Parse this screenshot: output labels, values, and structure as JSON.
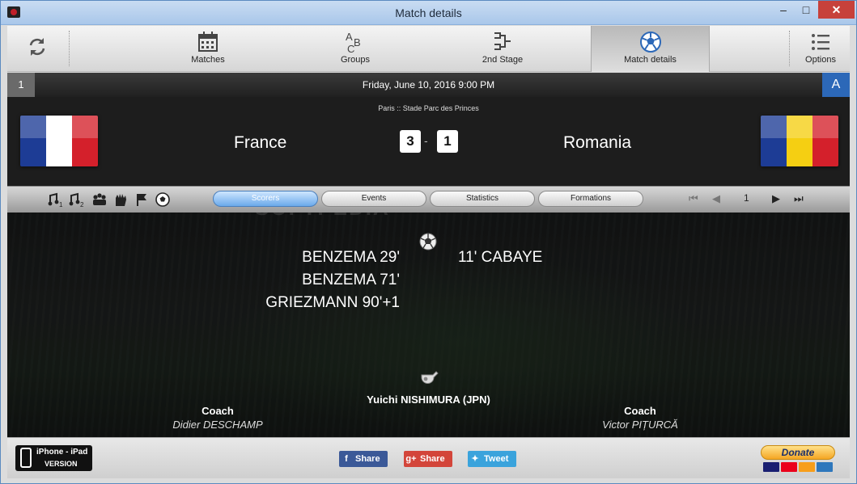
{
  "window": {
    "title": "Match details",
    "controls": {
      "minimize": "–",
      "maximize": "□",
      "close": "✕"
    }
  },
  "toolbar": {
    "refresh_icon": "refresh-icon",
    "items": [
      {
        "label": "Matches",
        "icon": "calendar-icon",
        "active": false
      },
      {
        "label": "Groups",
        "icon": "abc-icon",
        "active": false
      },
      {
        "label": "2nd Stage",
        "icon": "bracket-icon",
        "active": false
      },
      {
        "label": "Match details",
        "icon": "soccer-ball-icon",
        "active": true
      },
      {
        "label": "Options",
        "icon": "list-icon",
        "active": false
      }
    ]
  },
  "match_bar": {
    "match_number": "1",
    "datetime": "Friday, June 10, 2016 9:00 PM",
    "group": "A"
  },
  "match": {
    "venue": "Paris  ::  Stade Parc des Princes",
    "home": {
      "name": "France",
      "score": "3",
      "flag_colors": [
        "#1d3c95",
        "#ffffff",
        "#d4202b"
      ]
    },
    "away": {
      "name": "Romania",
      "score": "1",
      "flag_colors": [
        "#1d3c95",
        "#f5cf12",
        "#d4202b"
      ]
    },
    "score_separator": "-"
  },
  "detail_tabs": {
    "event_icons": [
      "first-half-icon",
      "second-half-icon",
      "lineup-icon",
      "glove-icon",
      "corner-flag-icon",
      "goal-ball-icon"
    ],
    "tabs": [
      {
        "label": "Scorers",
        "active": true
      },
      {
        "label": "Events",
        "active": false
      },
      {
        "label": "Statistics",
        "active": false
      },
      {
        "label": "Formations",
        "active": false
      }
    ],
    "pager": {
      "first": "⏮",
      "prev": "◀",
      "current": "1",
      "next": "▶",
      "last": "⏭"
    }
  },
  "watermark": "SOFTPEDIA",
  "scorers": {
    "home": [
      "BENZEMA 29'",
      "BENZEMA 71'",
      "GRIEZMANN 90'+1"
    ],
    "away": [
      "11' CABAYE"
    ]
  },
  "officials": {
    "referee": "Yuichi NISHIMURA (JPN)",
    "home_coach_label": "Coach",
    "home_coach": "Didier DESCHAMP",
    "away_coach_label": "Coach",
    "away_coach": "Victor PIȚURCĂ"
  },
  "footer": {
    "app_badge_line1": "iPhone - iPad",
    "app_badge_line2": "VERSION",
    "share_facebook": "Share",
    "share_google": "Share",
    "share_twitter": "Tweet",
    "donate": "Donate",
    "card_colors": [
      "#1a1f71",
      "#eb001b",
      "#f79e1b",
      "#2e77bc"
    ]
  }
}
